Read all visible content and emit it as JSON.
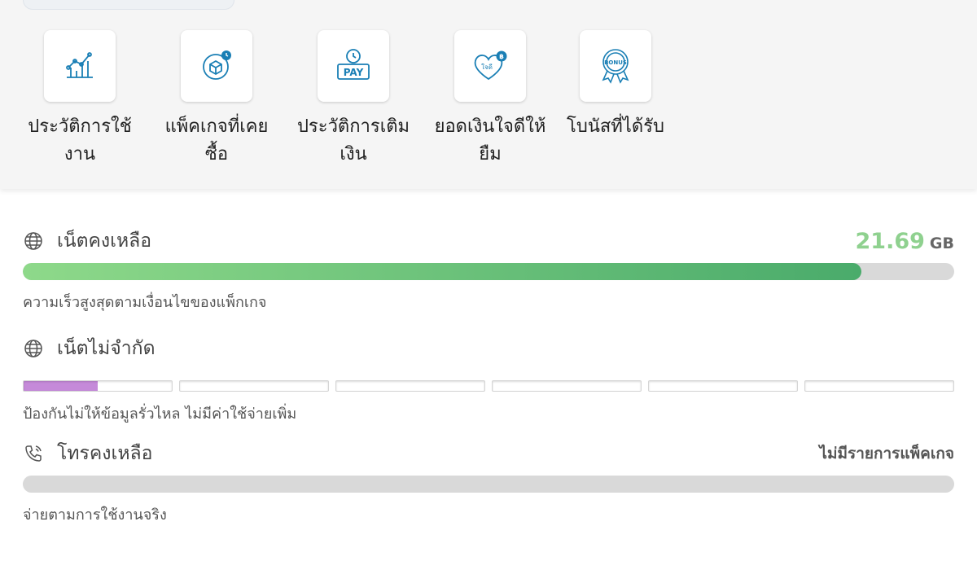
{
  "menu": {
    "items": [
      {
        "label_line1": "ประวัติการใช้",
        "label_line2": "งาน",
        "icon": "usage-chart-icon"
      },
      {
        "label_line1": "แพ็คเกจที่เคย",
        "label_line2": "ซื้อ",
        "icon": "package-history-icon"
      },
      {
        "label_line1": "ประวัติการเติม",
        "label_line2": "เงิน",
        "icon": "pay-history-icon",
        "icon_text": "PAY"
      },
      {
        "label_line1": "ยอดเงินใจดีให้",
        "label_line2": "ยืม",
        "icon": "heart-loan-icon",
        "icon_text": "ใจดี"
      },
      {
        "label_line1": "โบนัสที่ได้รับ",
        "label_line2": "",
        "icon": "bonus-badge-icon",
        "icon_text": "BONUS"
      }
    ]
  },
  "data_remaining": {
    "title": "เน็ตคงเหลือ",
    "amount": "21.69",
    "unit": "GB",
    "progress_percent": 90,
    "description": "ความเร็วสูงสุดตามเงื่อนไขของแพ็กเกจ",
    "icon": "globe-icon"
  },
  "unlimited": {
    "title": "เน็ตไม่จำกัด",
    "segments_total": 6,
    "segments_active_fraction": 0.5,
    "description": "ป้องกันไม่ให้ข้อมูลรั่วไหล ไม่มีค่าใช้จ่ายเพิ่ม",
    "icon": "globe-icon"
  },
  "voice": {
    "title": "โทรคงเหลือ",
    "status": "ไม่มีรายการแพ็คเกจ",
    "progress_percent": 0,
    "description": "จ่ายตามการใช้งานจริง",
    "icon": "phone-icon"
  },
  "colors": {
    "accent_green": "#8fd18f",
    "bar_green_end": "#4aab6b",
    "unlimited_purple": "#c58ad9",
    "icon_blue": "#1a7fb5"
  }
}
